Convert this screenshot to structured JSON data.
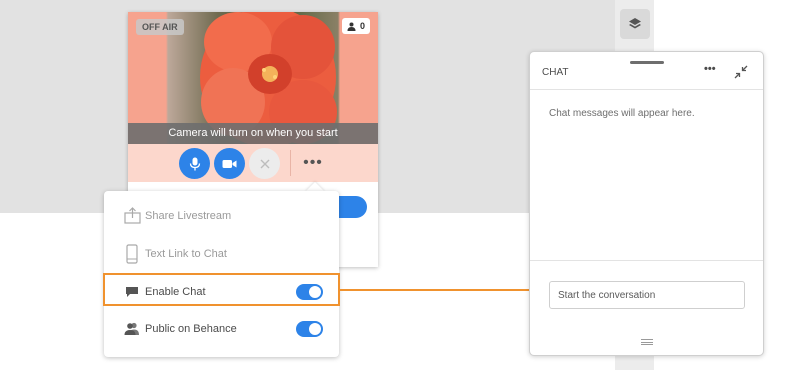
{
  "camera": {
    "status_badge": "OFF AIR",
    "viewer_count": "0",
    "caption": "Camera will turn on when you start",
    "controls": {
      "mic_icon": "microphone-icon",
      "video_icon": "video-camera-icon",
      "end_icon": "close-icon",
      "more_label": "•••"
    }
  },
  "menu": {
    "items": [
      {
        "label": "Share Livestream",
        "icon": "share-icon",
        "enabled": false
      },
      {
        "label": "Text Link to Chat",
        "icon": "phone-icon",
        "enabled": false
      },
      {
        "label": "Enable Chat",
        "icon": "chat-bubble-icon",
        "toggle": true,
        "toggle_on": true
      },
      {
        "label": "Public on Behance",
        "icon": "people-icon",
        "toggle": true,
        "toggle_on": true
      }
    ]
  },
  "chat": {
    "title": "CHAT",
    "more_label": "•••",
    "empty_message": "Chat messages will appear here.",
    "input_placeholder": "Start the conversation"
  },
  "colors": {
    "accent_blue": "#2d83e8",
    "highlight_orange": "#f0922e",
    "video_pink": "#f6a38e"
  }
}
